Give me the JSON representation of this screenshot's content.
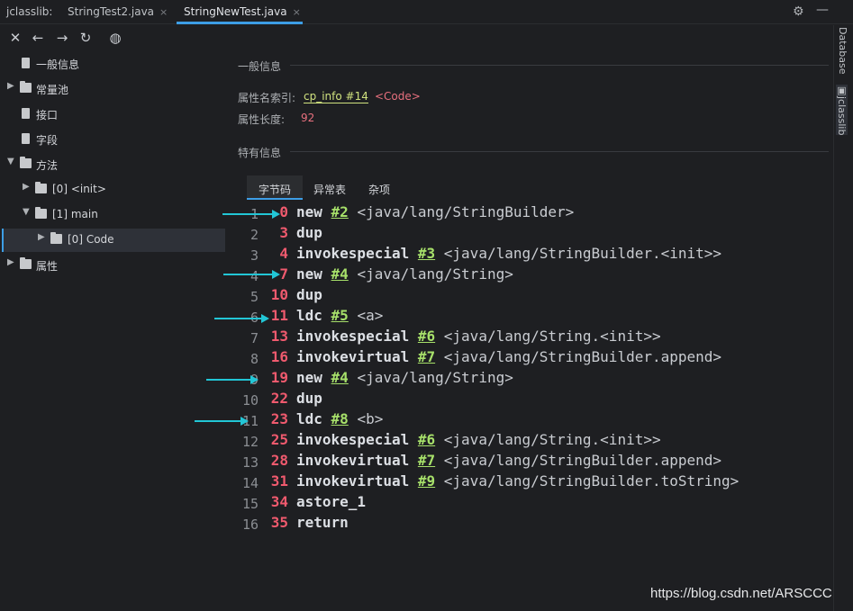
{
  "tabs": {
    "plugin_label": "jclasslib:",
    "items": [
      {
        "label": "StringTest2.java",
        "close": "×"
      },
      {
        "label": "StringNewTest.java",
        "close": "×"
      }
    ],
    "gear": "⚙",
    "minimize": "—"
  },
  "toolbar": {
    "close": "✕",
    "back": "←",
    "forward": "→",
    "refresh": "↻",
    "web": "◍"
  },
  "tree": {
    "general": "一般信息",
    "constant_pool": "常量池",
    "interfaces": "接口",
    "fields": "字段",
    "methods": "方法",
    "init": "[0] <init>",
    "main": "[1] main",
    "code": "[0] Code",
    "attributes": "属性"
  },
  "right_strip": {
    "database": "Database",
    "jclasslib": "jclasslib"
  },
  "info": {
    "general_title": "一般信息",
    "name_index_label": "属性名索引:",
    "name_index_link": "cp_info #14",
    "name_index_value": "<Code>",
    "length_label": "属性长度:",
    "length_value": "92",
    "specific_title": "特有信息"
  },
  "subtabs": {
    "bytecode": "字节码",
    "exceptions": "异常表",
    "misc": "杂项"
  },
  "bytecode": [
    {
      "ln": "1",
      "off": "0",
      "op": "new",
      "ref": "#2",
      "cmt": "<java/lang/StringBuilder>"
    },
    {
      "ln": "2",
      "off": "3",
      "op": "dup",
      "ref": "",
      "cmt": ""
    },
    {
      "ln": "3",
      "off": "4",
      "op": "invokespecial",
      "ref": "#3",
      "cmt": "<java/lang/StringBuilder.<init>>"
    },
    {
      "ln": "4",
      "off": "7",
      "op": "new",
      "ref": "#4",
      "cmt": "<java/lang/String>"
    },
    {
      "ln": "5",
      "off": "10",
      "op": "dup",
      "ref": "",
      "cmt": ""
    },
    {
      "ln": "6",
      "off": "11",
      "op": "ldc",
      "ref": "#5",
      "cmt": "<a>"
    },
    {
      "ln": "7",
      "off": "13",
      "op": "invokespecial",
      "ref": "#6",
      "cmt": "<java/lang/String.<init>>"
    },
    {
      "ln": "8",
      "off": "16",
      "op": "invokevirtual",
      "ref": "#7",
      "cmt": "<java/lang/StringBuilder.append>"
    },
    {
      "ln": "9",
      "off": "19",
      "op": "new",
      "ref": "#4",
      "cmt": "<java/lang/String>"
    },
    {
      "ln": "10",
      "off": "22",
      "op": "dup",
      "ref": "",
      "cmt": ""
    },
    {
      "ln": "11",
      "off": "23",
      "op": "ldc",
      "ref": "#8",
      "cmt": "<b>"
    },
    {
      "ln": "12",
      "off": "25",
      "op": "invokespecial",
      "ref": "#6",
      "cmt": "<java/lang/String.<init>>"
    },
    {
      "ln": "13",
      "off": "28",
      "op": "invokevirtual",
      "ref": "#7",
      "cmt": "<java/lang/StringBuilder.append>"
    },
    {
      "ln": "14",
      "off": "31",
      "op": "invokevirtual",
      "ref": "#9",
      "cmt": "<java/lang/StringBuilder.toString>"
    },
    {
      "ln": "15",
      "off": "34",
      "op": "astore_1",
      "ref": "",
      "cmt": ""
    },
    {
      "ln": "16",
      "off": "35",
      "op": "return",
      "ref": "",
      "cmt": ""
    }
  ],
  "colors": {
    "accent": "#3d9ee6",
    "arrow": "#22c6d6",
    "offset": "#f05a6e",
    "ref": "#a7e06a"
  },
  "watermark": "https://blog.csdn.net/ARSCCC"
}
